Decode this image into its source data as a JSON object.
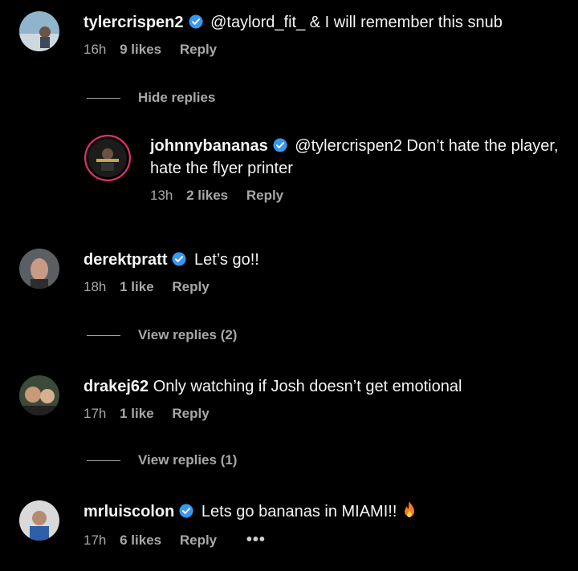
{
  "comments": [
    {
      "username": "tylercrispen2",
      "text": "@taylord_fit_ & I will remember this snub",
      "time": "16h",
      "likes": "9 likes",
      "reply": "Reply",
      "toggle": "Hide replies"
    },
    {
      "username": "johnnybananas",
      "text": "@tylercrispen2 Don’t hate the player, hate the flyer printer",
      "time": "13h",
      "likes": "2 likes",
      "reply": "Reply"
    },
    {
      "username": "derektpratt",
      "text": "Let’s go!!",
      "time": "18h",
      "likes": "1 like",
      "reply": "Reply",
      "toggle": "View replies (2)"
    },
    {
      "username": "drakej62",
      "text": "Only watching if Josh doesn’t get emotional",
      "time": "17h",
      "likes": "1 like",
      "reply": "Reply",
      "toggle": "View replies (1)"
    },
    {
      "username": "mrluiscolon",
      "text": "Lets go bananas in MIAMI!!",
      "time": "17h",
      "likes": "6 likes",
      "reply": "Reply",
      "more": "•••"
    }
  ],
  "colors": {
    "verified": "#3897f0",
    "muted": "#a8a8a8",
    "story_ring": "#e1306c"
  },
  "icons": [
    "verified-badge-icon",
    "fire-emoji-icon",
    "more-options-icon"
  ]
}
